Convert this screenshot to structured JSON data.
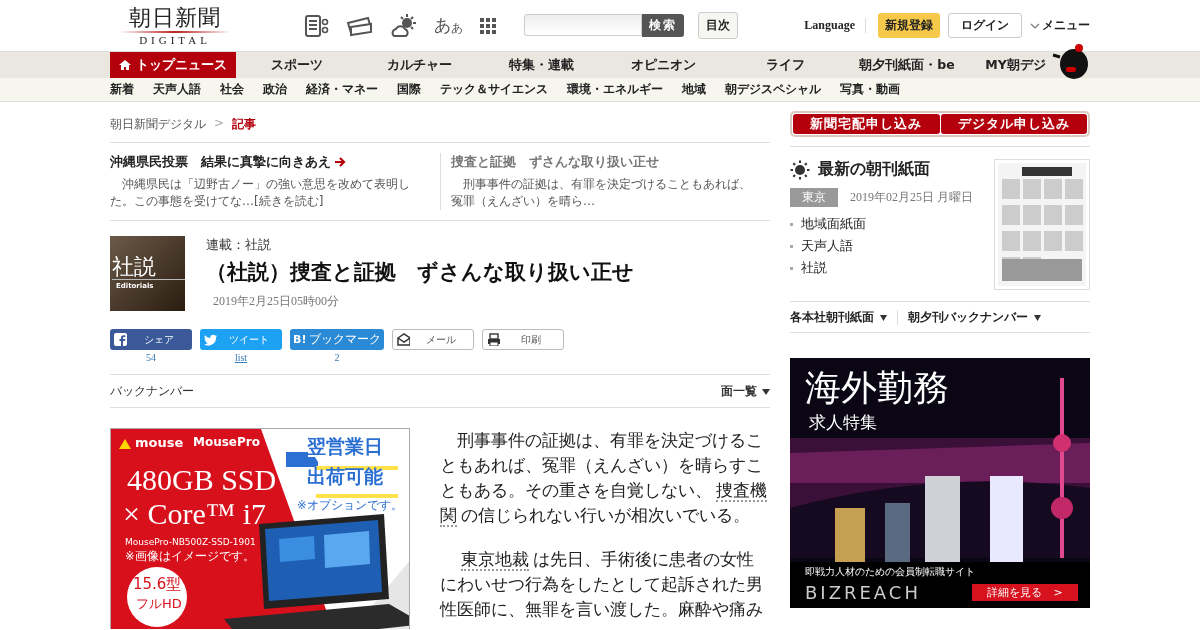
{
  "header": {
    "logo": "朝日新聞",
    "logo_sub": "DIGITAL",
    "font_icon": [
      "あ",
      "あ"
    ],
    "search_button": "検索",
    "index_button": "目次",
    "language": "Language",
    "register": "新規登録",
    "login": "ログイン",
    "menu": "メニュー"
  },
  "nav": [
    {
      "label": "トップニュース",
      "selected": true
    },
    {
      "label": "スポーツ",
      "selected": false
    },
    {
      "label": "カルチャー",
      "selected": false
    },
    {
      "label": "特集・連載",
      "selected": false
    },
    {
      "label": "オピニオン",
      "selected": false
    },
    {
      "label": "ライフ",
      "selected": false
    },
    {
      "label": "朝夕刊紙面・be",
      "selected": false
    },
    {
      "label": "MY朝デジ",
      "selected": false
    }
  ],
  "subnav": [
    "新着",
    "天声人語",
    "社会",
    "政治",
    "経済・マネー",
    "国際",
    "テック＆サイエンス",
    "環境・エネルギー",
    "地域",
    "朝デジスペシャル",
    "写真・動画"
  ],
  "breadcrumb": [
    "朝日新聞デジタル",
    "記事"
  ],
  "breadcrumb_separator": ">",
  "related": [
    {
      "title": "沖縄県民投票　結果に真摯に向きあえ",
      "summary": "沖縄県民は「辺野古ノー」の強い意思を改めて表明した。この事態を受けてな…",
      "more": "[続きを読む]",
      "current": false
    },
    {
      "title": "捜査と証拠　ずさんな取り扱い正せ",
      "summary": "刑事事件の証拠は、有罪を決定づけることもあれば、冤罪（えんざい）を晴ら…",
      "current": true
    }
  ],
  "article": {
    "badge": "社説",
    "badge_sub": "Editorials",
    "series": "連載：社説",
    "title": "（社説）捜査と証拠　ずさんな取り扱い正せ",
    "date": "2019年2月25日05時00分"
  },
  "share": [
    {
      "kind": "facebook",
      "label": "シェア",
      "count": "54"
    },
    {
      "kind": "twitter",
      "label": "ツイート",
      "count": "list"
    },
    {
      "kind": "hatena",
      "icon_text": "B!",
      "label": "ブックマーク",
      "count": "2"
    },
    {
      "kind": "mail",
      "label": "メール"
    },
    {
      "kind": "print",
      "label": "印刷"
    }
  ],
  "backnumber": {
    "label": "バックナンバー",
    "toggle": "面一覧"
  },
  "body": [
    [
      {
        "text": "刑事事件の証拠は、有罪を決定づけることもあれば、冤罪（えんざい）を晴らすこともある。その重さを自覚しない、"
      },
      {
        "text": "捜査機",
        "link": true
      },
      {
        "text": "関",
        "link": true
      },
      {
        "text": "の信じられない行いが相次いでいる。"
      }
    ],
    [
      {
        "text": "東京地裁",
        "link": true
      },
      {
        "text": "は先日、手術後に患者の女性にわいせつ行為をしたとして起訴された男性医師に、無罪を言い渡した。麻酔や痛み"
      }
    ]
  ],
  "ad_left": {
    "brand": "mouse",
    "brand2": "MousePro",
    "ship": [
      "翌営業日",
      "出荷可能"
    ],
    "option_note": "※オプションです。",
    "spec": "480GB SSD",
    "cpu": "× Core™ i7",
    "model": "MousePro-NB500Z-SSD-1901",
    "image_note": "※画像はイメージです。",
    "screen": [
      "15.6型",
      "フルHD"
    ]
  },
  "subscribe": [
    "新聞宅配申し込み",
    "デジタル申し込み"
  ],
  "paper": {
    "title": "最新の朝刊紙面",
    "edition": "東京",
    "date": "2019年02月25日 月曜日",
    "links": [
      "地域面紙面",
      "天声人語",
      "社説"
    ]
  },
  "dropdowns": [
    "各本社朝刊紙面",
    "朝夕刊バックナンバー"
  ],
  "ad_right": {
    "title": "海外勤務",
    "subtitle": "求人特集",
    "tagline": "即戦力人材のための会員制転職サイト",
    "logo": "BIZREACH",
    "button": "詳細を見る　>"
  }
}
